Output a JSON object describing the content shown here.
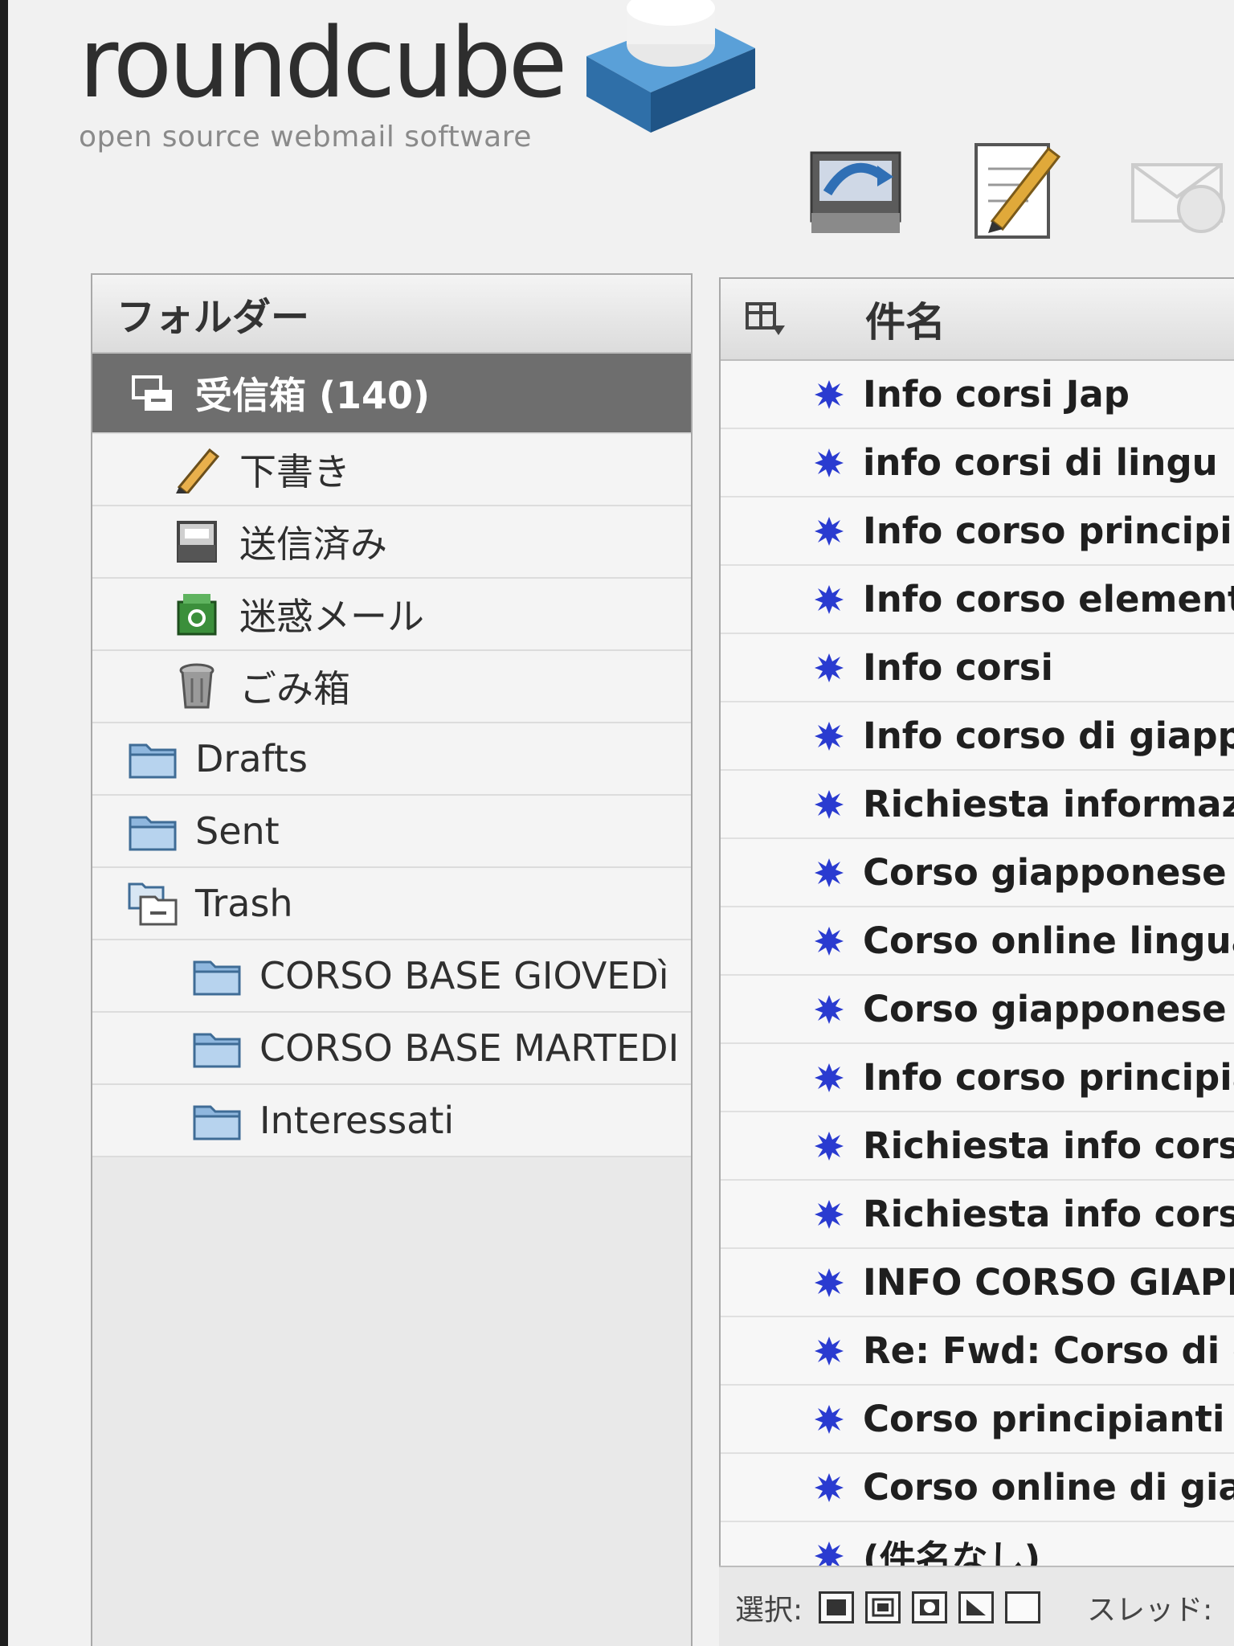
{
  "logo": {
    "name": "roundcube",
    "tagline": "open source webmail software"
  },
  "toolbar": [
    {
      "icon": "check-mail-icon"
    },
    {
      "icon": "compose-icon"
    },
    {
      "icon": "reply-icon"
    }
  ],
  "folders": {
    "header": "フォルダー",
    "items": [
      {
        "label": "受信箱 (140)",
        "icon": "inbox-icon",
        "selected": true
      },
      {
        "label": "下書き",
        "icon": "pencil-icon"
      },
      {
        "label": "送信済み",
        "icon": "sent-icon"
      },
      {
        "label": "迷惑メール",
        "icon": "junk-icon"
      },
      {
        "label": "ごみ箱",
        "icon": "trash-can-icon"
      },
      {
        "label": "Drafts",
        "icon": "folder-icon"
      },
      {
        "label": "Sent",
        "icon": "folder-icon"
      },
      {
        "label": "Trash",
        "icon": "folder-stack-icon"
      },
      {
        "label": "CORSO BASE GIOVEDì",
        "icon": "folder-icon"
      },
      {
        "label": "CORSO BASE MARTEDI",
        "icon": "folder-icon"
      },
      {
        "label": "Interessati",
        "icon": "folder-icon"
      }
    ]
  },
  "messages": {
    "header": "件名",
    "items": [
      "Info corsi Jap",
      "info corsi di lingu",
      "Info corso principi",
      "Info corso element",
      "Info corsi",
      "Info corso di giappo",
      "Richiesta informazio",
      "Corso giapponese",
      "Corso online lingua g",
      "Corso giapponese isc",
      "Info corso principiant",
      "Richiesta info corsi",
      "Richiesta info corso",
      "INFO CORSO GIAPPONE",
      "Re: Fwd: Corso di giapp",
      "Corso principianti Giapp",
      "Corso online di giappone",
      "(件名なし)"
    ]
  },
  "footer": {
    "select_label": "選択:",
    "thread_label": "スレッド:"
  },
  "colors": {
    "selected_bg": "#6e6e6e",
    "unread_dot": "#2a3bd0",
    "logo_blue": "#3a84c7"
  }
}
